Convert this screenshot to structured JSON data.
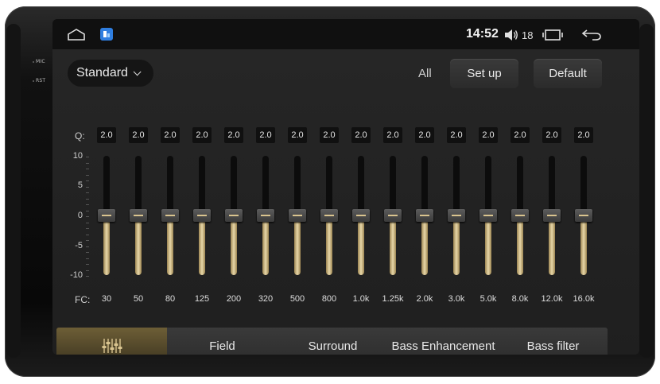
{
  "hardware": {
    "mic_label": "MIC",
    "rst_label": "RST"
  },
  "statusbar": {
    "time": "14:52",
    "volume": "18",
    "icons": [
      "home-icon",
      "app-icon",
      "volume-icon",
      "recent-apps-icon",
      "back-icon"
    ]
  },
  "header": {
    "preset": "Standard",
    "all_label": "All",
    "setup_label": "Set up",
    "default_label": "Default"
  },
  "equalizer": {
    "q_label": "Q:",
    "fc_label": "FC:",
    "scale": [
      "10",
      "5",
      "0",
      "-5",
      "-10"
    ],
    "bands": [
      {
        "fc": "30",
        "q": "2.0",
        "gain": 0
      },
      {
        "fc": "50",
        "q": "2.0",
        "gain": 0
      },
      {
        "fc": "80",
        "q": "2.0",
        "gain": 0
      },
      {
        "fc": "125",
        "q": "2.0",
        "gain": 0
      },
      {
        "fc": "200",
        "q": "2.0",
        "gain": 0
      },
      {
        "fc": "320",
        "q": "2.0",
        "gain": 0
      },
      {
        "fc": "500",
        "q": "2.0",
        "gain": 0
      },
      {
        "fc": "800",
        "q": "2.0",
        "gain": 0
      },
      {
        "fc": "1.0k",
        "q": "2.0",
        "gain": 0
      },
      {
        "fc": "1.25k",
        "q": "2.0",
        "gain": 0
      },
      {
        "fc": "2.0k",
        "q": "2.0",
        "gain": 0
      },
      {
        "fc": "3.0k",
        "q": "2.0",
        "gain": 0
      },
      {
        "fc": "5.0k",
        "q": "2.0",
        "gain": 0
      },
      {
        "fc": "8.0k",
        "q": "2.0",
        "gain": 0
      },
      {
        "fc": "12.0k",
        "q": "2.0",
        "gain": 0
      },
      {
        "fc": "16.0k",
        "q": "2.0",
        "gain": 0
      }
    ]
  },
  "tabs": [
    {
      "label": "",
      "icon": "equalizer-icon",
      "active": true
    },
    {
      "label": "Field",
      "active": false
    },
    {
      "label": "Surround",
      "active": false
    },
    {
      "label": "Bass Enhancement",
      "active": false
    },
    {
      "label": "Bass filter",
      "active": false
    }
  ],
  "colors": {
    "accent": "#d9c48f",
    "active_tab": "#6d5e36",
    "background": "#1f1f1f"
  }
}
